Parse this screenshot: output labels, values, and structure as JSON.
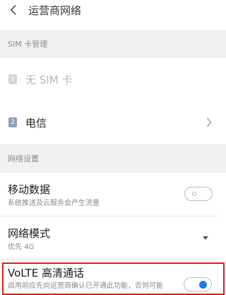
{
  "header": {
    "back_icon": "chevron-left-icon",
    "title": "运营商网络"
  },
  "sim_section": {
    "header": "SIM 卡管理",
    "slots": [
      {
        "badge": "1",
        "label": "无 SIM 卡",
        "enabled": false,
        "badge_color": "#d4d4d4"
      },
      {
        "badge": "2",
        "label": "电信",
        "enabled": true,
        "badge_color": "#8aa1b8",
        "chevron_icon": "chevron-right-icon"
      }
    ]
  },
  "network_section": {
    "header": "网络设置",
    "mobile_data": {
      "title": "移动数据",
      "subtitle": "系统推送及云服务会产生流量",
      "toggle_on": false
    },
    "network_mode": {
      "title": "网络模式",
      "subtitle": "优先 4G",
      "caret_icon": "caret-down-icon"
    },
    "volte": {
      "title": "VoLTE 高清通话",
      "subtitle": "启用前应先向运营商确认已开通此功能，否则可能",
      "toggle_on": true
    }
  },
  "colors": {
    "accent": "#1e7ce6",
    "highlight": "#e01b1b",
    "section_bg": "#f1f1f1"
  }
}
